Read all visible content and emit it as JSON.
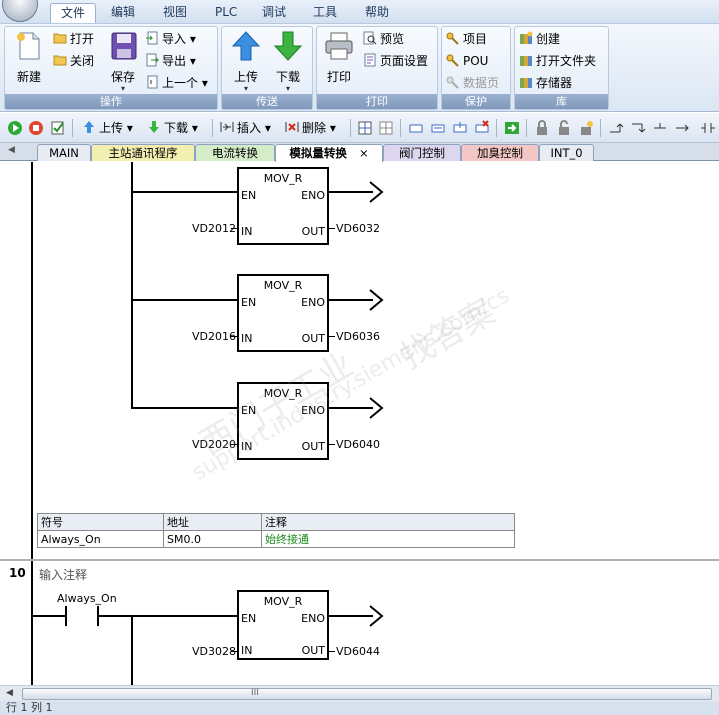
{
  "menu": {
    "tabs": [
      "文件",
      "编辑",
      "视图",
      "PLC",
      "调试",
      "工具",
      "帮助"
    ]
  },
  "ribbon": {
    "operate": {
      "label": "操作",
      "new": "新建",
      "open": "打开",
      "close": "关闭",
      "save": "保存",
      "import": "导入",
      "export": "导出",
      "previous": "上一个"
    },
    "transfer": {
      "label": "传送",
      "upload": "上传",
      "download": "下载"
    },
    "print": {
      "label": "打印",
      "print": "打印",
      "preview": "预览",
      "page_setup": "页面设置"
    },
    "protect": {
      "label": "保护",
      "project": "项目",
      "pou": "POU",
      "data_page": "数据页"
    },
    "library": {
      "label": "库",
      "create": "创建",
      "open_folder": "打开文件夹",
      "memory": "存储器"
    }
  },
  "toolbar": {
    "upload": "上传",
    "download": "下载",
    "insert": "插入",
    "delete": "删除"
  },
  "tabs": [
    "MAIN",
    "主站通讯程序",
    "电流转换",
    "模拟量转换",
    "阀门控制",
    "加臭控制",
    "INT_0"
  ],
  "tab_close": "×",
  "net9": {
    "blocks": [
      {
        "title": "MOV_R",
        "in": "VD2012",
        "out": "VD6032"
      },
      {
        "title": "MOV_R",
        "in": "VD2016",
        "out": "VD6036"
      },
      {
        "title": "MOV_R",
        "in": "VD2020",
        "out": "VD6040"
      }
    ],
    "pins": {
      "en": "EN",
      "eno": "ENO",
      "in": "IN",
      "out": "OUT"
    },
    "symbol_table": {
      "headers": [
        "符号",
        "地址",
        "注释"
      ],
      "row": [
        "Always_On",
        "SM0.0",
        "始终接通"
      ]
    }
  },
  "net10": {
    "number": "10",
    "comment": "输入注释",
    "contact": "Always_On",
    "block": {
      "title": "MOV_R",
      "in": "VD3028",
      "out": "VD6044"
    }
  },
  "watermark": {
    "line1": "找答案",
    "line2": "support.industry.siemens.com/cs",
    "line3": "西门子工业"
  },
  "scroll": {
    "grip": "III"
  },
  "status": {
    "text": "行 1  列 1"
  }
}
